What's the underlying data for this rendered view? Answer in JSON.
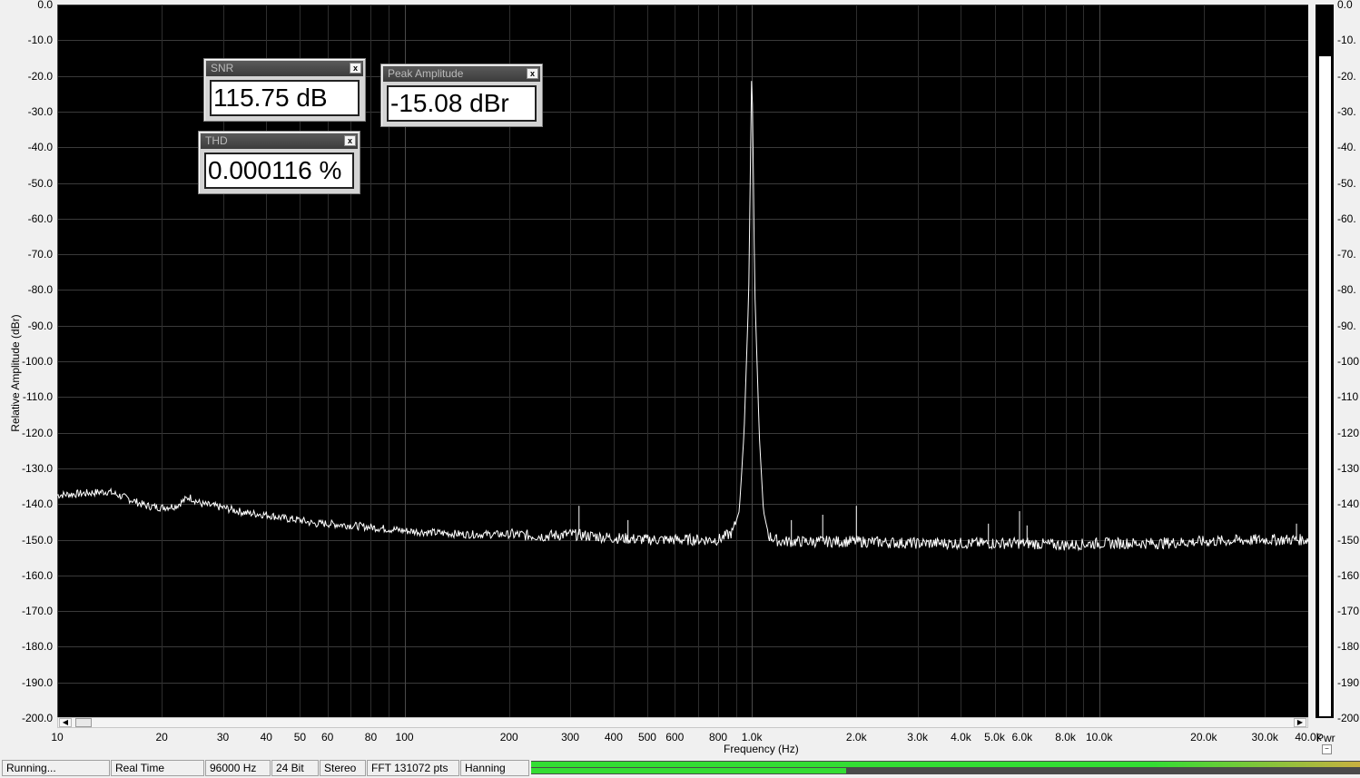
{
  "chart_data": {
    "type": "line",
    "xscale": "log",
    "xlim": [
      10,
      40000
    ],
    "ylim": [
      -200,
      0
    ],
    "xlabel": "Frequency (Hz)",
    "ylabel": "Relative Amplitude (dBr)",
    "grid": true,
    "y_ticks": [
      "0.0",
      "-10.0",
      "-20.0",
      "-30.0",
      "-40.0",
      "-50.0",
      "-60.0",
      "-70.0",
      "-80.0",
      "-90.0",
      "-100.0",
      "-110.0",
      "-120.0",
      "-130.0",
      "-140.0",
      "-150.0",
      "-160.0",
      "-170.0",
      "-180.0",
      "-190.0",
      "-200.0"
    ],
    "x_tick_labels": [
      {
        "v": 10,
        "t": "10"
      },
      {
        "v": 20,
        "t": "20"
      },
      {
        "v": 30,
        "t": "30"
      },
      {
        "v": 40,
        "t": "40"
      },
      {
        "v": 50,
        "t": "50"
      },
      {
        "v": 60,
        "t": "60"
      },
      {
        "v": 80,
        "t": "80"
      },
      {
        "v": 100,
        "t": "100"
      },
      {
        "v": 200,
        "t": "200"
      },
      {
        "v": 300,
        "t": "300"
      },
      {
        "v": 400,
        "t": "400"
      },
      {
        "v": 500,
        "t": "500"
      },
      {
        "v": 600,
        "t": "600"
      },
      {
        "v": 800,
        "t": "800"
      },
      {
        "v": 1000,
        "t": "1.0k"
      },
      {
        "v": 2000,
        "t": "2.0k"
      },
      {
        "v": 3000,
        "t": "3.0k"
      },
      {
        "v": 4000,
        "t": "4.0k"
      },
      {
        "v": 5000,
        "t": "5.0k"
      },
      {
        "v": 6000,
        "t": "6.0k"
      },
      {
        "v": 8000,
        "t": "8.0k"
      },
      {
        "v": 10000,
        "t": "10.0k"
      },
      {
        "v": 20000,
        "t": "20.0k"
      },
      {
        "v": 30000,
        "t": "30.0k"
      },
      {
        "v": 40000,
        "t": "40.0k"
      }
    ],
    "right_ticks": [
      "0.0",
      "-10.",
      "-20.",
      "-30.",
      "-40.",
      "-50.",
      "-60.",
      "-70.",
      "-80.",
      "-90.",
      "-100",
      "-110",
      "-120",
      "-130",
      "-140",
      "-150",
      "-160",
      "-170",
      "-180",
      "-190",
      "-200"
    ],
    "series": [
      {
        "values": [
          [
            10,
            -137.5
          ],
          [
            12,
            -137
          ],
          [
            14,
            -136.5
          ],
          [
            16,
            -138.5
          ],
          [
            18,
            -140.5
          ],
          [
            20,
            -141
          ],
          [
            22,
            -140.5
          ],
          [
            24,
            -138
          ],
          [
            26,
            -140
          ],
          [
            30,
            -141
          ],
          [
            35,
            -142.5
          ],
          [
            40,
            -143
          ],
          [
            45,
            -144
          ],
          [
            50,
            -144.5
          ],
          [
            55,
            -145.5
          ],
          [
            60,
            -145.5
          ],
          [
            70,
            -146
          ],
          [
            80,
            -146.5
          ],
          [
            90,
            -147
          ],
          [
            100,
            -147.5
          ],
          [
            120,
            -148
          ],
          [
            150,
            -148.5
          ],
          [
            200,
            -148.5
          ],
          [
            250,
            -149
          ],
          [
            300,
            -148.5
          ],
          [
            350,
            -149
          ],
          [
            400,
            -149.5
          ],
          [
            500,
            -150
          ],
          [
            600,
            -150
          ],
          [
            700,
            -150
          ],
          [
            800,
            -150
          ],
          [
            880,
            -148
          ],
          [
            920,
            -142
          ],
          [
            950,
            -120
          ],
          [
            980,
            -80
          ],
          [
            1000,
            -15.1
          ],
          [
            1020,
            -80
          ],
          [
            1050,
            -120
          ],
          [
            1080,
            -142
          ],
          [
            1120,
            -149
          ],
          [
            1200,
            -150.5
          ],
          [
            1500,
            -150.5
          ],
          [
            2000,
            -150.5
          ],
          [
            3000,
            -151
          ],
          [
            4000,
            -151
          ],
          [
            6000,
            -151
          ],
          [
            8000,
            -151.5
          ],
          [
            10000,
            -151
          ],
          [
            15000,
            -151
          ],
          [
            20000,
            -150.5
          ],
          [
            30000,
            -150
          ],
          [
            40000,
            -150
          ]
        ],
        "spurs": [
          [
            318,
            -140.5
          ],
          [
            440,
            -144.5
          ],
          [
            1300,
            -144.5
          ],
          [
            1600,
            -143
          ],
          [
            2000,
            -140.5
          ],
          [
            5900,
            -142
          ],
          [
            4800,
            -145.5
          ],
          [
            6200,
            -146
          ],
          [
            37000,
            -145.5
          ]
        ]
      }
    ]
  },
  "widgets": {
    "snr": {
      "title": "SNR",
      "value": "115.75 dB",
      "close": "x"
    },
    "peak": {
      "title": "Peak Amplitude",
      "value": "-15.08 dBr",
      "close": "x"
    },
    "thd": {
      "title": "THD",
      "value": "0.000116 %",
      "close": "x"
    }
  },
  "meter": {
    "label": "Pwr",
    "level_db": -14.5
  },
  "statusbar": {
    "state": "Running...",
    "mode": "Real Time",
    "sample_rate": "96000 Hz",
    "bit_depth": "24 Bit",
    "channels": "Stereo",
    "fft": "FFT 131072 pts",
    "window": "Hanning",
    "level_left": 1.0,
    "level_right": 0.38,
    "level_color": "#33dd33"
  }
}
